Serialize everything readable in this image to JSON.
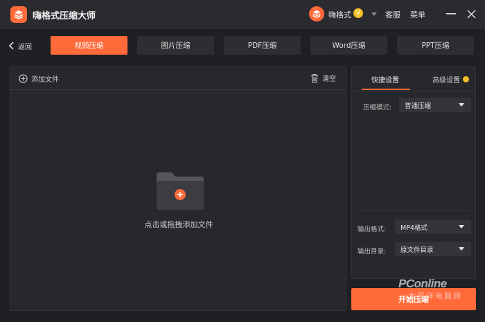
{
  "app": {
    "title": "嗨格式压缩大师",
    "user_name": "嗨格式",
    "vip_symbol": "V",
    "service_label": "客服",
    "menu_label": "菜单"
  },
  "nav": {
    "back_label": "返回",
    "tabs": [
      {
        "label": "视频压缩",
        "active": true
      },
      {
        "label": "图片压缩",
        "active": false
      },
      {
        "label": "PDF压缩",
        "active": false
      },
      {
        "label": "Word压缩",
        "active": false
      },
      {
        "label": "PPT压缩",
        "active": false
      }
    ]
  },
  "file_panel": {
    "add_file_label": "添加文件",
    "clear_label": "清空",
    "drop_hint": "点击或拖拽添加文件"
  },
  "settings": {
    "tabs": [
      {
        "label": "快捷设置",
        "active": true
      },
      {
        "label": "高级设置",
        "active": false
      }
    ],
    "compress_mode": {
      "label": "压缩模式:",
      "value": "普通压缩"
    },
    "output_format": {
      "label": "输出格式:",
      "value": "MP4格式"
    },
    "output_dir": {
      "label": "输出目录:",
      "value": "原文件目录"
    }
  },
  "start_button_label": "开始压缩",
  "watermark": {
    "main": "PConline",
    "sub": "太平洋电脑网"
  },
  "colors": {
    "accent": "#ff6a3a",
    "background": "#1f2023",
    "panel": "#27282b",
    "vip": "#f2c028"
  }
}
